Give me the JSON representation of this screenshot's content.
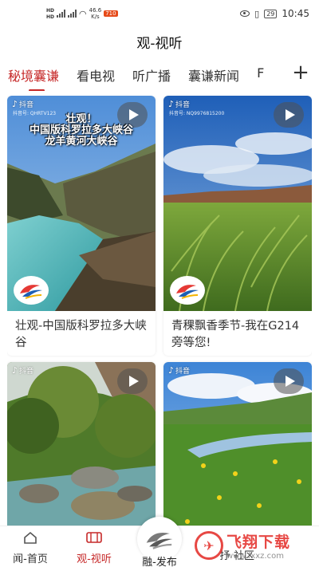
{
  "status_bar": {
    "sim1": "HD",
    "sim2": "HD",
    "net_speed": "46.6",
    "net_unit": "K/s",
    "notif": "710",
    "battery": "29",
    "time": "10:45"
  },
  "header": {
    "title": "观-视听"
  },
  "tabs": [
    {
      "label": "秘境囊谦"
    },
    {
      "label": "看电视"
    },
    {
      "label": "听广播"
    },
    {
      "label": "囊谦新闻"
    },
    {
      "label": "F"
    }
  ],
  "cards": [
    {
      "platform": "抖音",
      "douyin_id": "抖音号: QHRTV123",
      "overlay": [
        "壮观！",
        "中国版科罗拉多大峡谷",
        "龙羊黄河大峡谷"
      ],
      "caption": "壮观-中国版科罗拉多大峡谷"
    },
    {
      "platform": "抖音",
      "douyin_id": "抖音号: NQ9976815200",
      "overlay": [],
      "caption": "青稞飘香季节-我在G214旁等您!"
    },
    {
      "platform": "抖音",
      "douyin_id": "",
      "overlay": [],
      "caption": ""
    },
    {
      "platform": "抖音",
      "douyin_id": "",
      "overlay": [],
      "caption": ""
    }
  ],
  "bottom_nav": {
    "items": [
      {
        "label": "闻-首页",
        "icon": "home-icon"
      },
      {
        "label": "观-视听",
        "icon": "film-icon"
      },
      {
        "label": "融-发布",
        "icon": "app-logo-icon"
      },
      {
        "label": "抒",
        "icon": ""
      },
      {
        "label": "社区",
        "icon": ""
      }
    ]
  },
  "watermark": {
    "main": "飞翔下载",
    "url": "www.fxxz.com"
  },
  "colors": {
    "accent": "#c62828"
  }
}
